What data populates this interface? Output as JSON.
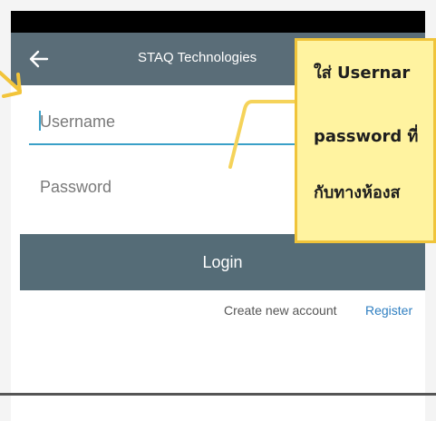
{
  "app_bar": {
    "title": "STAQ Technologies"
  },
  "login_form": {
    "username_placeholder": "Username",
    "password_placeholder": "Password",
    "login_label": "Login",
    "create_account_text": "Create new account",
    "register_label": "Register"
  },
  "callout": {
    "lines": [
      "ใส่ Usernar",
      "password ที่",
      "กับทางห้องส"
    ]
  },
  "colors": {
    "app_bar": "#5a6d78",
    "login_button": "#556c77",
    "accent": "#3aa0c8",
    "link": "#2f7fc1",
    "callout_fill": "#fff3a0",
    "callout_border": "#f0c43a"
  },
  "icons": [
    "back-arrow-icon",
    "annotation-arrow-icon"
  ]
}
